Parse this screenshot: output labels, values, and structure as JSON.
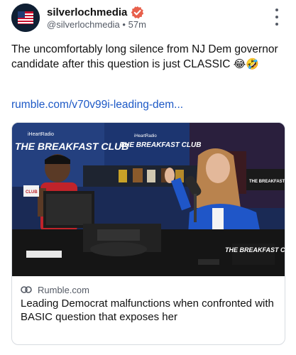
{
  "post": {
    "author_name": "silverlochmedia",
    "handle": "@silverlochmedia",
    "separator": "•",
    "timestamp": "57m",
    "text": "The uncomfortably long silence from NJ Dem governor candidate after this question is just CLASSIC",
    "emojis": "😂🤣",
    "link_text": "rumble.com/v70v99i-leading-dem..."
  },
  "card": {
    "domain": "Rumble.com",
    "title": "Leading Democrat malfunctions when confronted with BASIC question that exposes her",
    "video_branding": {
      "station": "iHeartRadio",
      "show": "THE BREAKFAST CLUB",
      "mic_flag": "CLUB",
      "corner_logo": "THE BREAKFAST CLUB"
    }
  },
  "icons": {
    "verified": "verified-badge-icon",
    "more": "more-options-icon",
    "link": "link-icon"
  },
  "colors": {
    "verified_badge": "#e8604c",
    "link": "#1d59c6",
    "muted_text": "#555b66",
    "card_border": "#d7dbe0"
  }
}
